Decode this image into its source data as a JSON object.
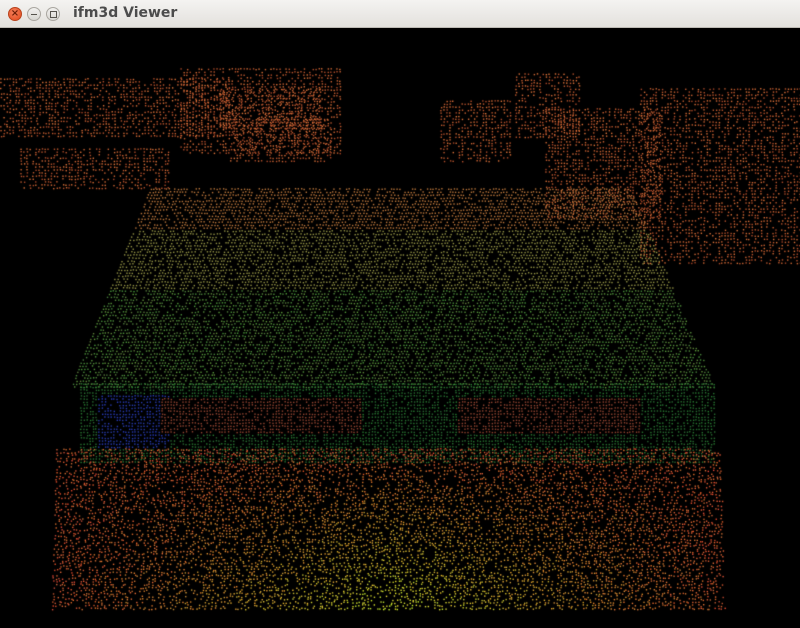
{
  "window": {
    "title": "ifm3d Viewer",
    "close_glyph": "×",
    "controls": [
      "close-icon",
      "minimize-icon",
      "maximize-icon"
    ]
  },
  "viewer": {
    "background": "#000000",
    "point_cloud_colormap": [
      "#2a2aa8",
      "#2f7a3a",
      "#c8c820",
      "#c9703a",
      "#a03a2a"
    ]
  }
}
